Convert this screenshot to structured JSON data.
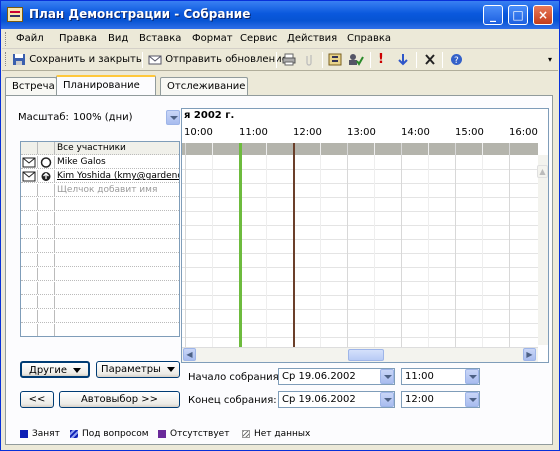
{
  "window": {
    "title": "План Демонстрации - Собрание",
    "minimize_icon": "minimize-icon",
    "maximize_icon": "maximize-icon",
    "close_icon": "close-icon"
  },
  "menu": {
    "items": [
      "Файл",
      "Правка",
      "Вид",
      "Вставка",
      "Формат",
      "Сервис",
      "Действия",
      "Справка"
    ]
  },
  "toolbar": {
    "save_close": "Сохранить и закрыть",
    "send_update": "Отправить обновление",
    "icons": [
      "save-close-icon",
      "send-update-icon",
      "print-icon",
      "attach-icon",
      "address-book-icon",
      "check-names-icon",
      "high-importance-icon",
      "low-importance-icon",
      "delete-icon",
      "help-icon"
    ]
  },
  "tabs": [
    {
      "label": "Встреча",
      "active": false
    },
    {
      "label": "Планирование",
      "active": true
    },
    {
      "label": "Отслеживание",
      "active": false
    }
  ],
  "scheduling": {
    "zoom_label": "Масштаб:",
    "zoom_value": "100% (дни)",
    "date_header": "я 2002 г.",
    "hours": [
      "10:00",
      "11:00",
      "12:00",
      "13:00",
      "14:00",
      "15:00",
      "16:00"
    ],
    "attendees_header": "Все участники",
    "attendees": [
      {
        "name": "Mike Galos",
        "icon": "organizer-icon"
      },
      {
        "name": "Kim Yoshida (kmy@gardeno",
        "icon": "required-attendee-icon"
      }
    ],
    "add_placeholder": "Щелчок добавит имя",
    "other_button": "Другие",
    "options_button": "Параметры",
    "prev_button": "<<",
    "autopick_button": "Автовыбор >>",
    "start_label": "Начало собрания:",
    "start_date": "Ср 19.06.2002",
    "start_time": "11:00",
    "end_label": "Конец собрания:",
    "end_date": "Ср 19.06.2002",
    "end_time": "12:00"
  },
  "legend": {
    "busy": "Занят",
    "tentative": "Под вопросом",
    "out_of_office": "Отсутствует",
    "no_info": "Нет данных"
  },
  "colors": {
    "titlebar": "#0a58dd",
    "busy": "#0d1fb5",
    "tentative": "#4c5fd6",
    "out_of_office": "#6a2a9a",
    "meeting_start": "#6dbb3d",
    "meeting_end": "#6b3f2a"
  }
}
